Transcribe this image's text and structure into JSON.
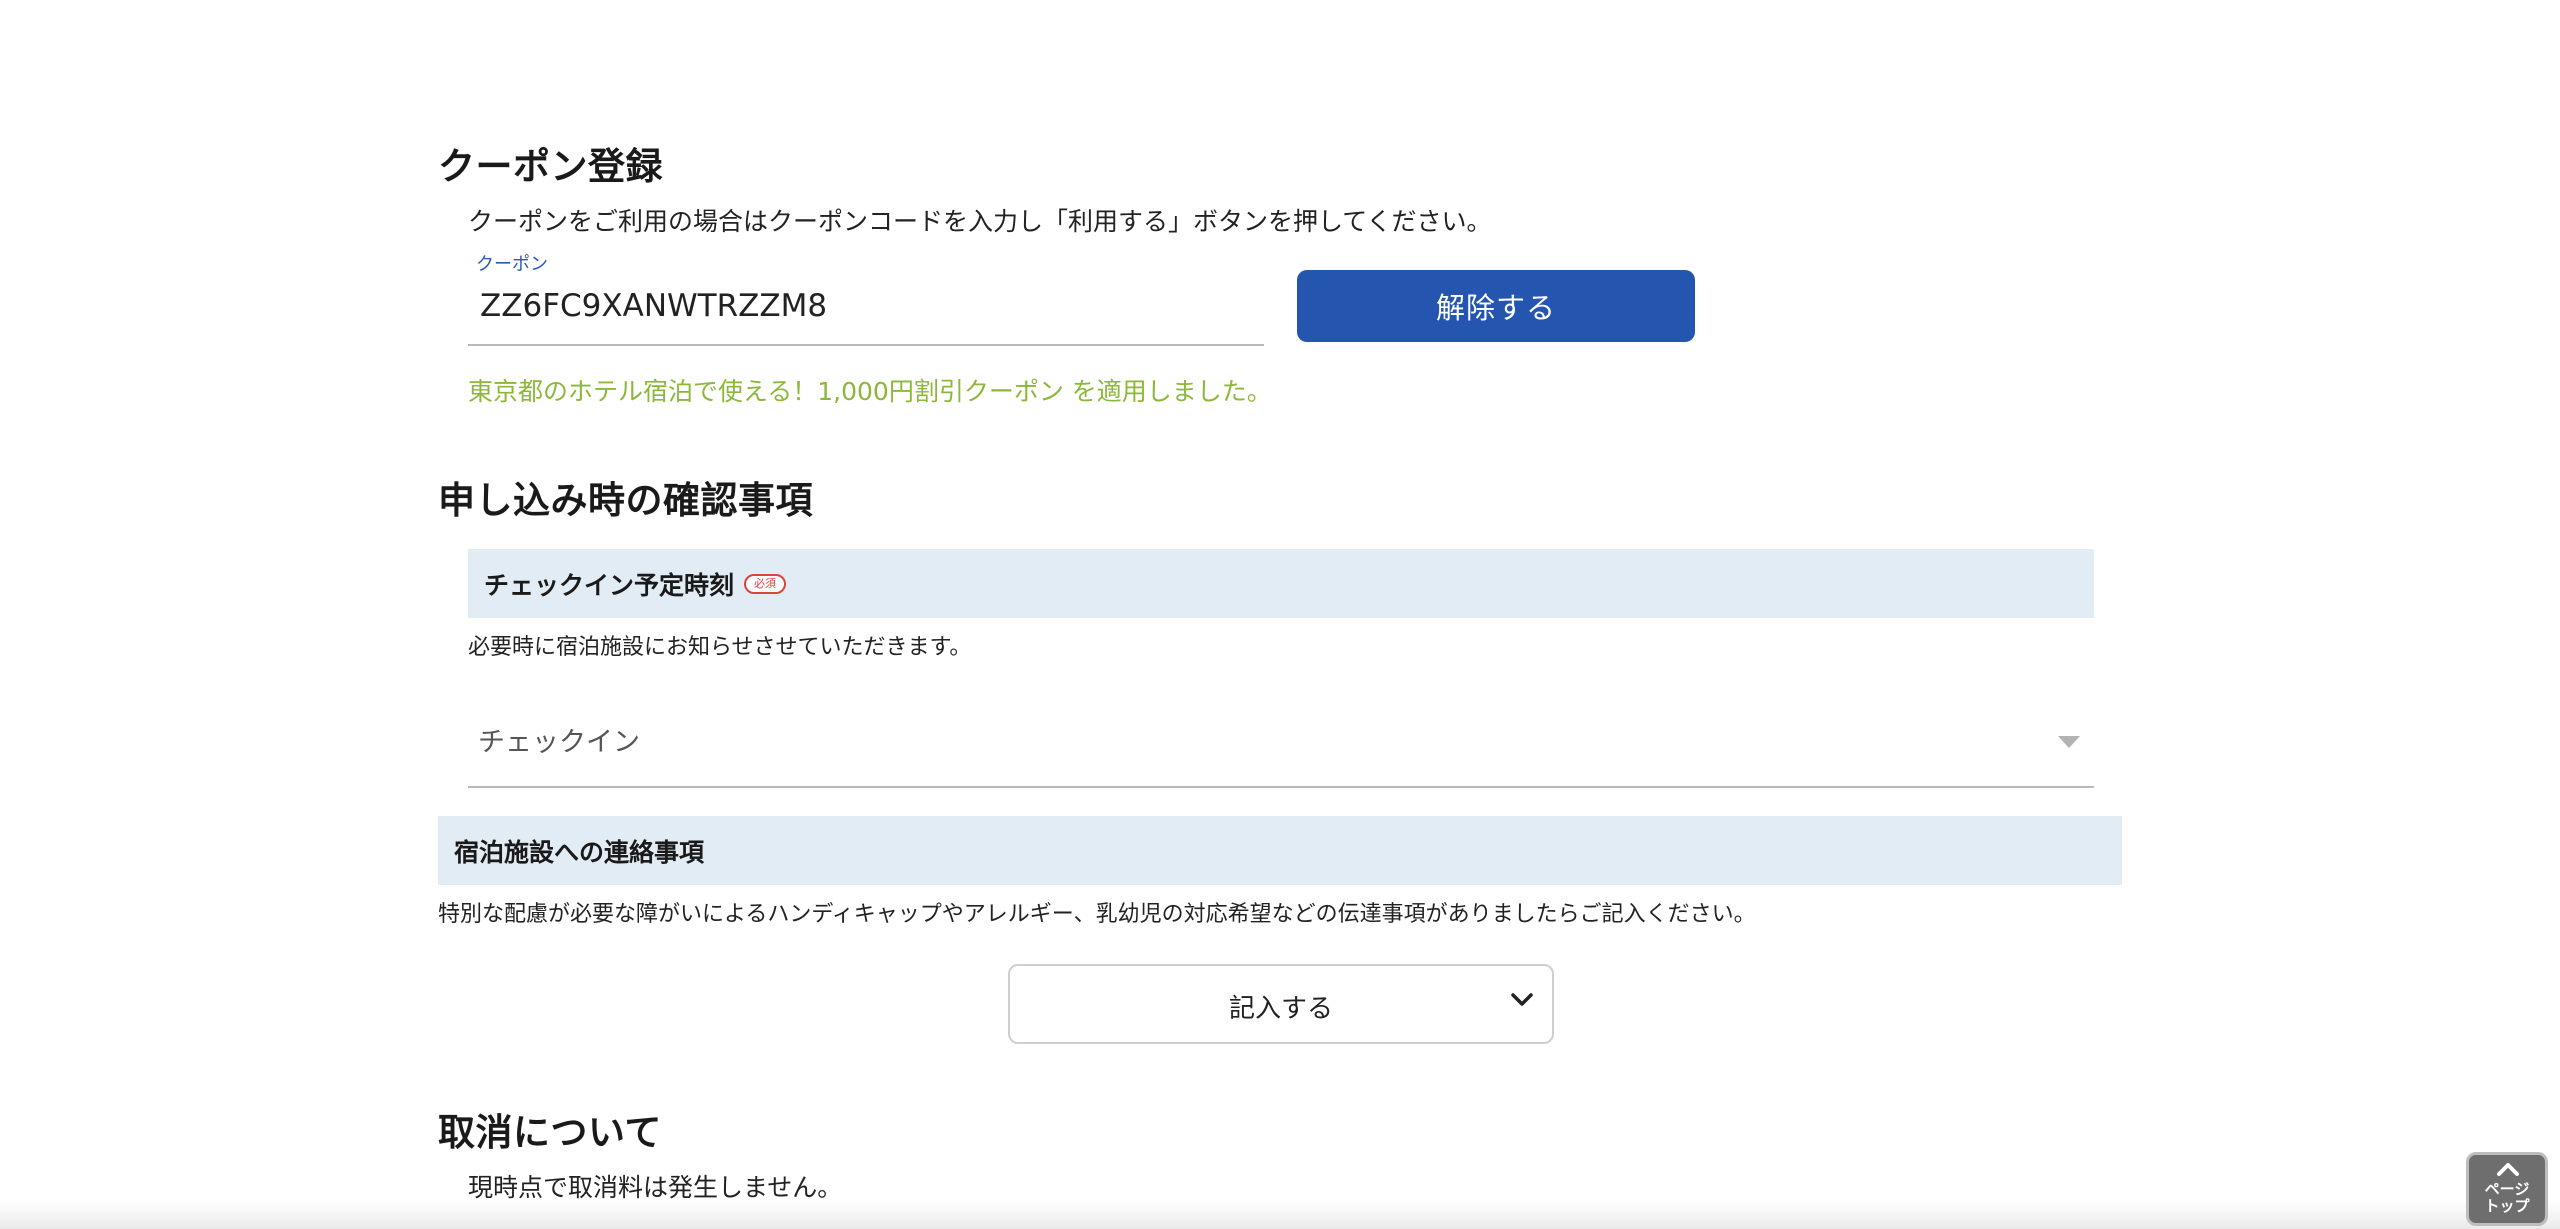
{
  "coupon": {
    "title": "クーポン登録",
    "instruction": "クーポンをご利用の場合はクーポンコードを入力し「利用する」ボタンを押してください。",
    "field_label": "クーポン",
    "field_value": "ZZ6FC9XANWTRZZM8",
    "release_button": "解除する",
    "success_message": "東京都のホテル宿泊で使える！1,000円割引クーポン を適用しました。"
  },
  "confirmation": {
    "title": "申し込み時の確認事項",
    "checkin": {
      "header": "チェックイン予定時刻",
      "required_badge": "必須",
      "note": "必要時に宿泊施設にお知らせさせていただきます。",
      "select_value": "チェックイン"
    },
    "contact": {
      "header": "宿泊施設への連絡事項",
      "note": "特別な配慮が必要な障がいによるハンディキャップやアレルギー、乳幼児の対応希望などの伝達事項がありましたらご記入ください。",
      "expand_button": "記入する"
    }
  },
  "cancellation": {
    "title": "取消について",
    "text": "現時点で取消料は発生しません。"
  },
  "page_top": {
    "line1": "ページ",
    "line2": "トップ"
  },
  "colors": {
    "primary": "#2456b0",
    "success": "#8cb83a",
    "band": "#e2ecf5",
    "required": "#d8453d"
  }
}
